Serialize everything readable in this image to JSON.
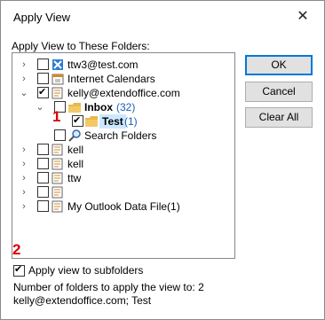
{
  "window": {
    "title": "Apply View",
    "close_glyph": "✕"
  },
  "section_label": "Apply View to These Folders:",
  "tree": {
    "items": [
      {
        "label": "ttw3@test.com",
        "icon": "exchange-account-icon",
        "checked": false,
        "expander": "collapsed"
      },
      {
        "label": "Internet Calendars",
        "icon": "calendar-folder-icon",
        "checked": false,
        "expander": "collapsed"
      },
      {
        "label": "kelly@extendoffice.com",
        "icon": "mailbox-folder-icon",
        "checked": true,
        "expander": "expanded"
      },
      {
        "label": "Inbox",
        "count": "(32)",
        "icon": "inbox-folder-icon",
        "checked": false,
        "expander": "expanded"
      },
      {
        "label": "Test",
        "count": "(1)",
        "icon": "folder-icon",
        "checked": true,
        "expander": "none"
      },
      {
        "label": "Search Folders",
        "icon": "search-folder-icon",
        "checked": false,
        "expander": "none"
      },
      {
        "label": "kell",
        "icon": "mailbox-folder-icon",
        "checked": false,
        "expander": "collapsed"
      },
      {
        "label": "kell",
        "icon": "mailbox-folder-icon",
        "checked": false,
        "expander": "collapsed"
      },
      {
        "label": "ttw",
        "icon": "mailbox-folder-icon",
        "checked": false,
        "expander": "collapsed"
      },
      {
        "label": "",
        "icon": "mailbox-folder-icon",
        "checked": false,
        "expander": "collapsed"
      },
      {
        "label": "My Outlook Data File(1)",
        "icon": "mailbox-folder-icon",
        "checked": false,
        "expander": "collapsed"
      }
    ]
  },
  "buttons": {
    "ok": "OK",
    "cancel": "Cancel",
    "clear_all": "Clear All"
  },
  "annotations": {
    "one": "1",
    "two": "2"
  },
  "subfolders": {
    "label": "Apply view to subfolders",
    "checked": true
  },
  "info": {
    "count_line": "Number of folders to apply the view to: 2",
    "folders_line": "kelly@extendoffice.com; Test"
  },
  "colors": {
    "accent": "#0078d7",
    "selection": "#cce8ff",
    "badge": "#d00000",
    "count": "#1a5fb4"
  }
}
